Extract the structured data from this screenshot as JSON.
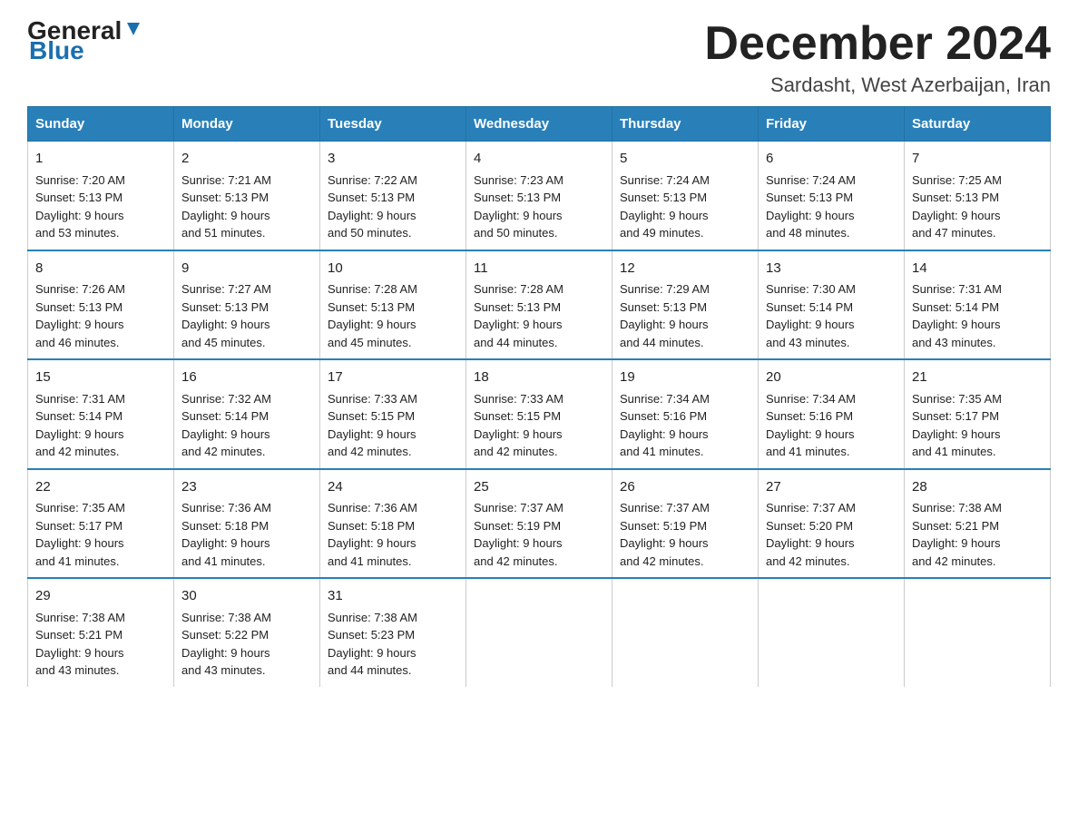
{
  "header": {
    "logo_general": "General",
    "logo_blue": "Blue",
    "title": "December 2024",
    "subtitle": "Sardasht, West Azerbaijan, Iran"
  },
  "columns": [
    "Sunday",
    "Monday",
    "Tuesday",
    "Wednesday",
    "Thursday",
    "Friday",
    "Saturday"
  ],
  "weeks": [
    [
      {
        "day": "1",
        "sunrise": "7:20 AM",
        "sunset": "5:13 PM",
        "daylight": "9 hours and 53 minutes."
      },
      {
        "day": "2",
        "sunrise": "7:21 AM",
        "sunset": "5:13 PM",
        "daylight": "9 hours and 51 minutes."
      },
      {
        "day": "3",
        "sunrise": "7:22 AM",
        "sunset": "5:13 PM",
        "daylight": "9 hours and 50 minutes."
      },
      {
        "day": "4",
        "sunrise": "7:23 AM",
        "sunset": "5:13 PM",
        "daylight": "9 hours and 50 minutes."
      },
      {
        "day": "5",
        "sunrise": "7:24 AM",
        "sunset": "5:13 PM",
        "daylight": "9 hours and 49 minutes."
      },
      {
        "day": "6",
        "sunrise": "7:24 AM",
        "sunset": "5:13 PM",
        "daylight": "9 hours and 48 minutes."
      },
      {
        "day": "7",
        "sunrise": "7:25 AM",
        "sunset": "5:13 PM",
        "daylight": "9 hours and 47 minutes."
      }
    ],
    [
      {
        "day": "8",
        "sunrise": "7:26 AM",
        "sunset": "5:13 PM",
        "daylight": "9 hours and 46 minutes."
      },
      {
        "day": "9",
        "sunrise": "7:27 AM",
        "sunset": "5:13 PM",
        "daylight": "9 hours and 45 minutes."
      },
      {
        "day": "10",
        "sunrise": "7:28 AM",
        "sunset": "5:13 PM",
        "daylight": "9 hours and 45 minutes."
      },
      {
        "day": "11",
        "sunrise": "7:28 AM",
        "sunset": "5:13 PM",
        "daylight": "9 hours and 44 minutes."
      },
      {
        "day": "12",
        "sunrise": "7:29 AM",
        "sunset": "5:13 PM",
        "daylight": "9 hours and 44 minutes."
      },
      {
        "day": "13",
        "sunrise": "7:30 AM",
        "sunset": "5:14 PM",
        "daylight": "9 hours and 43 minutes."
      },
      {
        "day": "14",
        "sunrise": "7:31 AM",
        "sunset": "5:14 PM",
        "daylight": "9 hours and 43 minutes."
      }
    ],
    [
      {
        "day": "15",
        "sunrise": "7:31 AM",
        "sunset": "5:14 PM",
        "daylight": "9 hours and 42 minutes."
      },
      {
        "day": "16",
        "sunrise": "7:32 AM",
        "sunset": "5:14 PM",
        "daylight": "9 hours and 42 minutes."
      },
      {
        "day": "17",
        "sunrise": "7:33 AM",
        "sunset": "5:15 PM",
        "daylight": "9 hours and 42 minutes."
      },
      {
        "day": "18",
        "sunrise": "7:33 AM",
        "sunset": "5:15 PM",
        "daylight": "9 hours and 42 minutes."
      },
      {
        "day": "19",
        "sunrise": "7:34 AM",
        "sunset": "5:16 PM",
        "daylight": "9 hours and 41 minutes."
      },
      {
        "day": "20",
        "sunrise": "7:34 AM",
        "sunset": "5:16 PM",
        "daylight": "9 hours and 41 minutes."
      },
      {
        "day": "21",
        "sunrise": "7:35 AM",
        "sunset": "5:17 PM",
        "daylight": "9 hours and 41 minutes."
      }
    ],
    [
      {
        "day": "22",
        "sunrise": "7:35 AM",
        "sunset": "5:17 PM",
        "daylight": "9 hours and 41 minutes."
      },
      {
        "day": "23",
        "sunrise": "7:36 AM",
        "sunset": "5:18 PM",
        "daylight": "9 hours and 41 minutes."
      },
      {
        "day": "24",
        "sunrise": "7:36 AM",
        "sunset": "5:18 PM",
        "daylight": "9 hours and 41 minutes."
      },
      {
        "day": "25",
        "sunrise": "7:37 AM",
        "sunset": "5:19 PM",
        "daylight": "9 hours and 42 minutes."
      },
      {
        "day": "26",
        "sunrise": "7:37 AM",
        "sunset": "5:19 PM",
        "daylight": "9 hours and 42 minutes."
      },
      {
        "day": "27",
        "sunrise": "7:37 AM",
        "sunset": "5:20 PM",
        "daylight": "9 hours and 42 minutes."
      },
      {
        "day": "28",
        "sunrise": "7:38 AM",
        "sunset": "5:21 PM",
        "daylight": "9 hours and 42 minutes."
      }
    ],
    [
      {
        "day": "29",
        "sunrise": "7:38 AM",
        "sunset": "5:21 PM",
        "daylight": "9 hours and 43 minutes."
      },
      {
        "day": "30",
        "sunrise": "7:38 AM",
        "sunset": "5:22 PM",
        "daylight": "9 hours and 43 minutes."
      },
      {
        "day": "31",
        "sunrise": "7:38 AM",
        "sunset": "5:23 PM",
        "daylight": "9 hours and 44 minutes."
      },
      null,
      null,
      null,
      null
    ]
  ]
}
